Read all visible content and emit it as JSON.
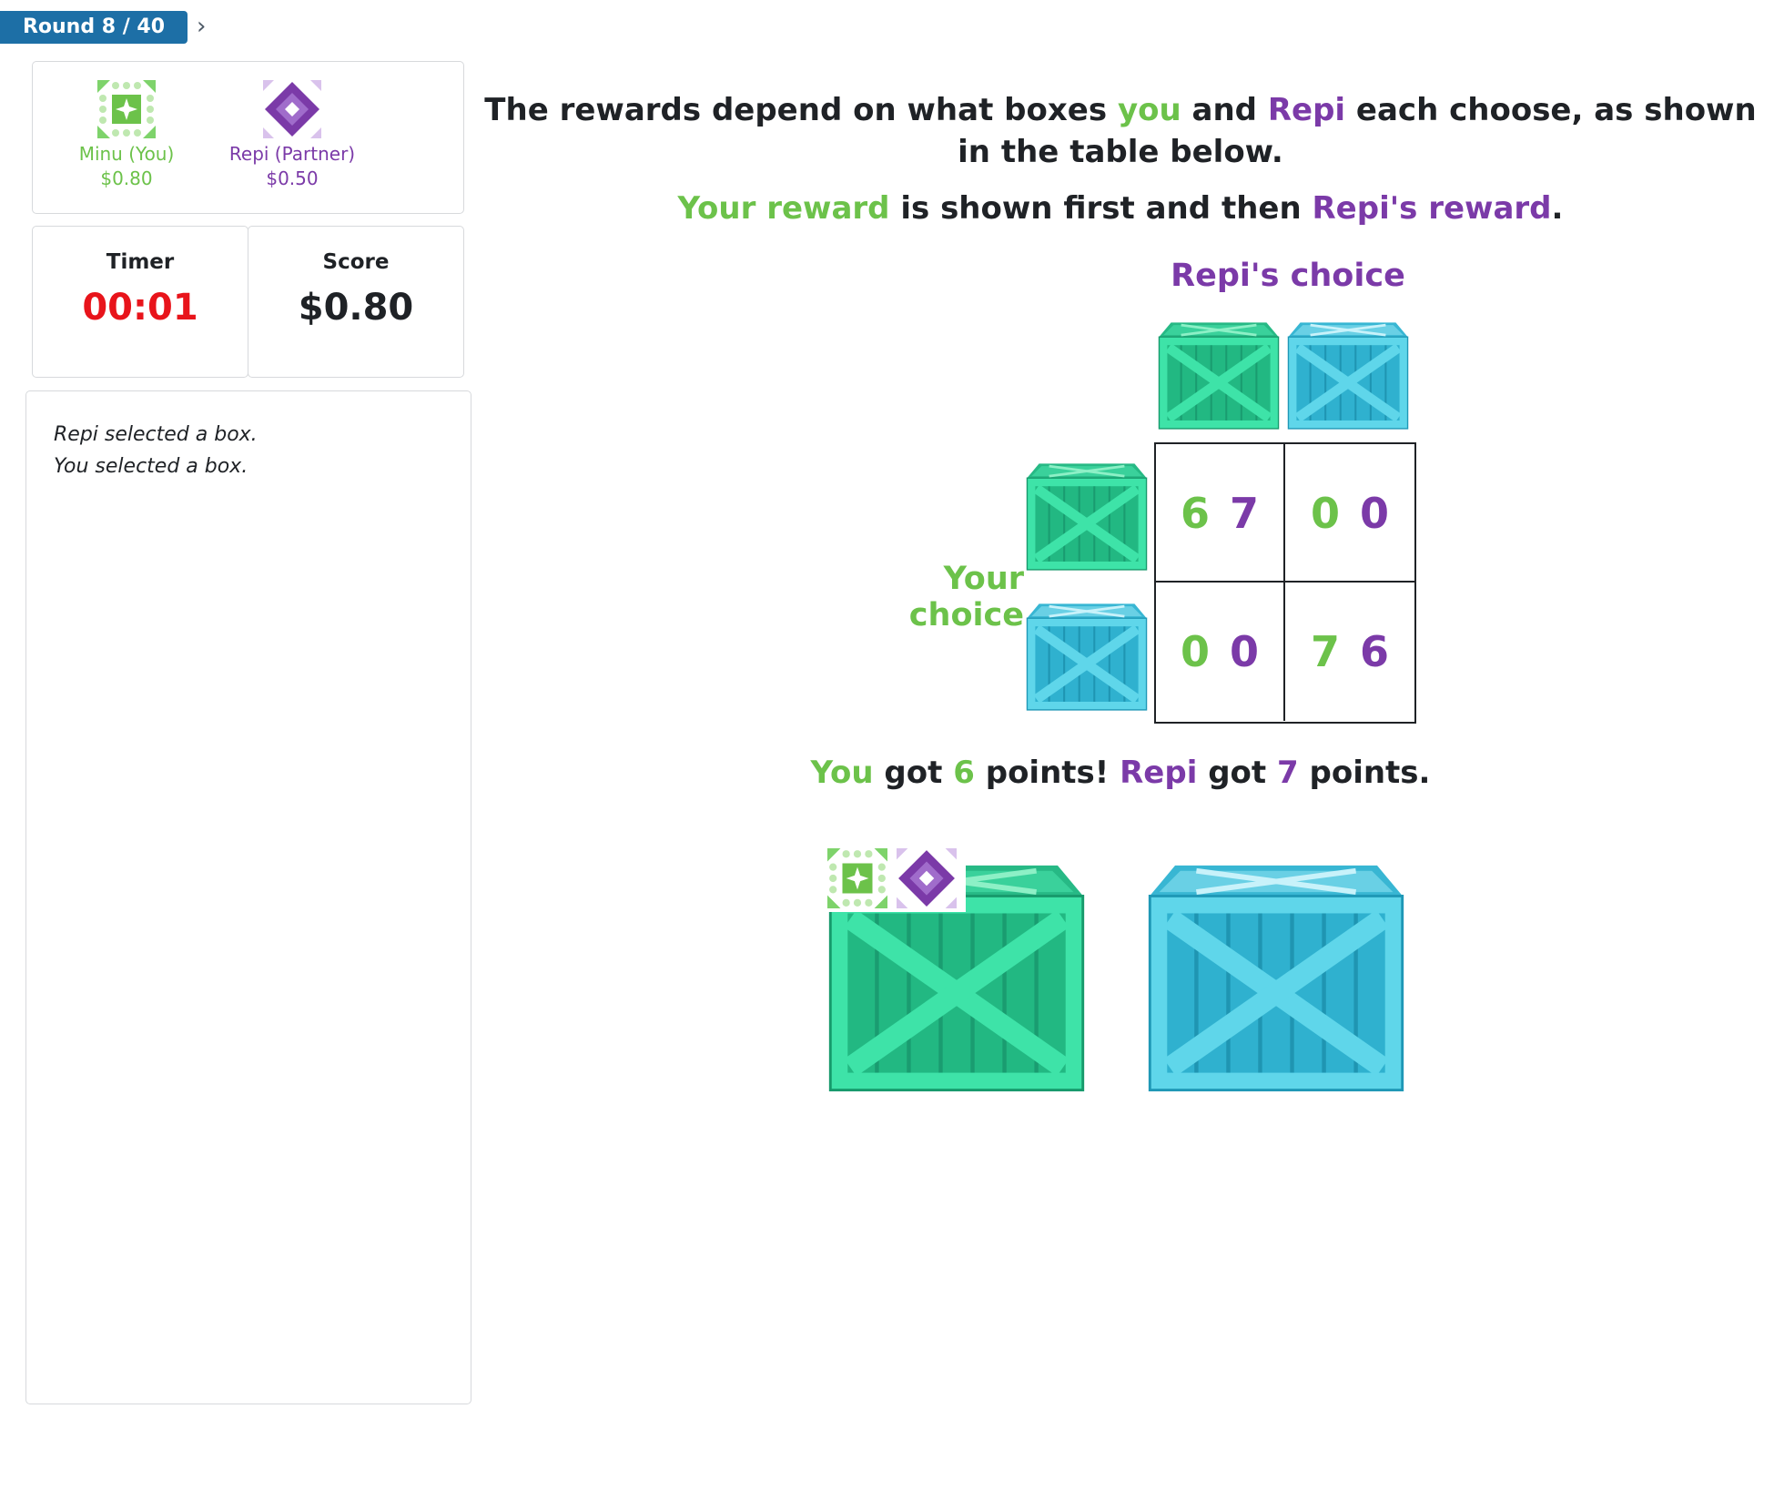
{
  "round": {
    "label": "Round 8 / 40"
  },
  "players": {
    "you": {
      "name": "Minu (You)",
      "amount": "$0.80"
    },
    "partner": {
      "name": "Repi (Partner)",
      "amount": "$0.50"
    }
  },
  "timer": {
    "label": "Timer",
    "value": "00:01"
  },
  "score": {
    "label": "Score",
    "value": "$0.80"
  },
  "log": [
    "Repi selected a box.",
    "You selected a box."
  ],
  "headline": {
    "p1": "The rewards depend on what boxes ",
    "you": "you",
    "p2": " and ",
    "repi": "Repi",
    "p3": " each choose, as shown in the table below."
  },
  "subline": {
    "your_reward": "Your reward",
    "mid": " is shown first and then ",
    "repi_reward": "Repi's reward",
    "end": "."
  },
  "labels": {
    "repi_choice": "Repi's choice",
    "your_choice": "Your choice"
  },
  "payoffs": [
    [
      {
        "you": "6",
        "repi": "7"
      },
      {
        "you": "0",
        "repi": "0"
      }
    ],
    [
      {
        "you": "0",
        "repi": "0"
      },
      {
        "you": "7",
        "repi": "6"
      }
    ]
  ],
  "result": {
    "you": "You",
    "got1": " got ",
    "you_points": "6",
    "pts1": " points! ",
    "repi": "Repi",
    "got2": " got ",
    "repi_points": "7",
    "pts2": " points."
  },
  "colors": {
    "you": "#6cc24a",
    "partner": "#7b3aa8",
    "accent": "#1d6fa6",
    "timer": "#e8141b",
    "crate_green": "#2fd39a",
    "crate_blue": "#3ec8e0"
  },
  "icons": {
    "you_avatar": "green-star-quilt-icon",
    "partner_avatar": "purple-diamond-quilt-icon",
    "crate_green": "green-crate-icon",
    "crate_blue": "blue-crate-icon"
  }
}
